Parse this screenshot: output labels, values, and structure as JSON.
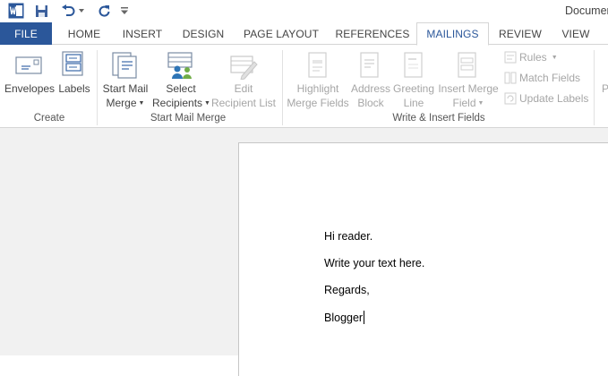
{
  "titlebar": {
    "app_icon": "word-icon",
    "doc_title": "Documer",
    "save_icon": "save-icon",
    "undo_icon": "undo-icon",
    "redo_icon": "redo-icon",
    "customize_icon": "customize-qat-icon"
  },
  "tabs": [
    {
      "label": "FILE"
    },
    {
      "label": "HOME"
    },
    {
      "label": "INSERT"
    },
    {
      "label": "DESIGN"
    },
    {
      "label": "PAGE LAYOUT"
    },
    {
      "label": "REFERENCES"
    },
    {
      "label": "MAILINGS"
    },
    {
      "label": "REVIEW"
    },
    {
      "label": "VIEW"
    }
  ],
  "active_tab": "MAILINGS",
  "ribbon": {
    "create": {
      "group_label": "Create",
      "envelopes": "Envelopes",
      "labels": "Labels"
    },
    "start_mail_merge": {
      "group_label": "Start Mail Merge",
      "start_line1": "Start Mail",
      "start_line2": "Merge",
      "select_line1": "Select",
      "select_line2": "Recipients",
      "edit_line1": "Edit",
      "edit_line2": "Recipient List"
    },
    "write_insert": {
      "group_label": "Write & Insert Fields",
      "highlight_line1": "Highlight",
      "highlight_line2": "Merge Fields",
      "address_line1": "Address",
      "address_line2": "Block",
      "greeting_line1": "Greeting",
      "greeting_line2": "Line",
      "insert_line1": "Insert Merge",
      "insert_line2": "Field",
      "rules": "Rules",
      "match_fields": "Match Fields",
      "update_labels": "Update Labels"
    },
    "partial_next": "P"
  },
  "document": {
    "lines": [
      "Hi reader.",
      "Write your text here.",
      "Regards,",
      "Blogger"
    ]
  },
  "colors": {
    "accent": "#2b579a",
    "disabled_text": "#a6a6a6",
    "doc_background": "#f1f1f1"
  }
}
